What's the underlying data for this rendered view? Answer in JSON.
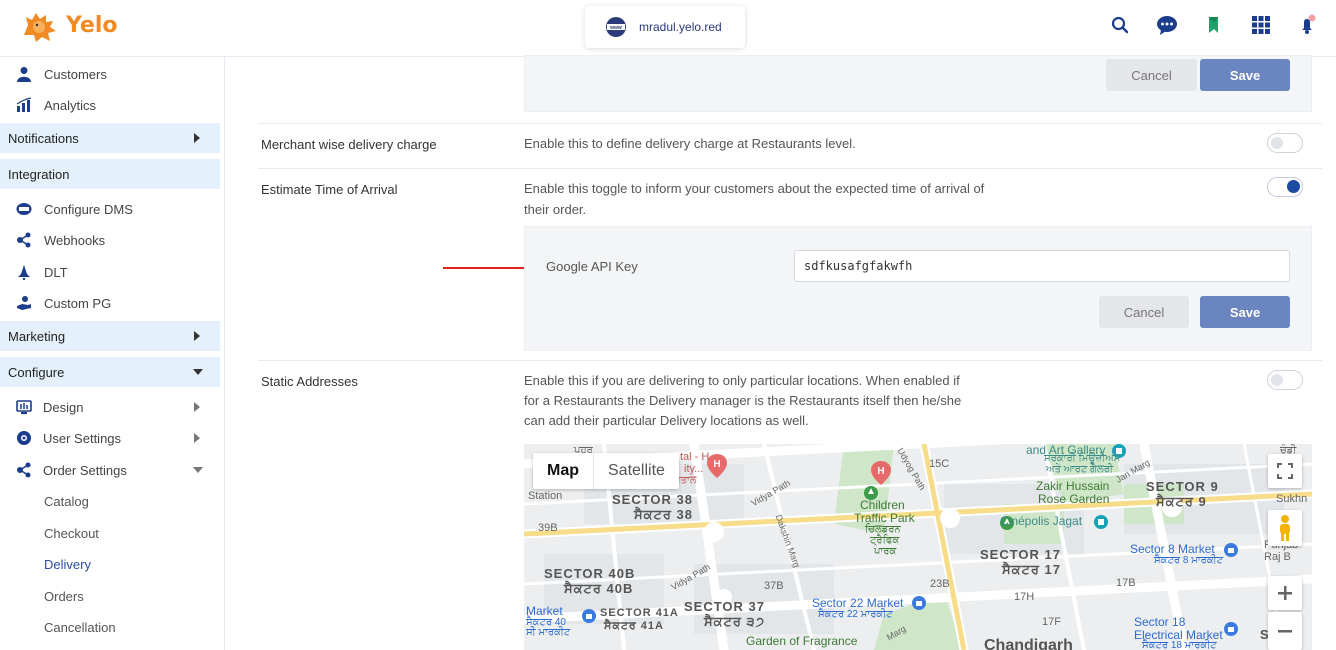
{
  "header": {
    "brand": "Yelo",
    "domain": "mradul.yelo.red",
    "icons": [
      "search-icon",
      "chat-support-icon",
      "bookmark-icon",
      "apps-grid-icon",
      "notification-icon"
    ]
  },
  "sidebar": {
    "top_items": [
      {
        "label": "Customers",
        "icon": "customers-icon"
      },
      {
        "label": "Analytics",
        "icon": "analytics-icon"
      }
    ],
    "notifications": "Notifications",
    "integration": "Integration",
    "integration_items": [
      {
        "label": "Configure DMS",
        "icon": "dms-icon"
      },
      {
        "label": "Webhooks",
        "icon": "webhooks-icon"
      },
      {
        "label": "DLT",
        "icon": "dlt-icon"
      },
      {
        "label": "Custom PG",
        "icon": "custom-pg-icon"
      }
    ],
    "marketing": "Marketing",
    "configure": "Configure",
    "configure_items": [
      {
        "label": "Design",
        "icon": "design-icon"
      },
      {
        "label": "User Settings",
        "icon": "user-settings-icon"
      },
      {
        "label": "Order Settings",
        "icon": "order-settings-icon"
      }
    ],
    "order_settings_items": [
      "Catalog",
      "Checkout",
      "Delivery",
      "Orders",
      "Cancellation"
    ],
    "active_item": "Delivery"
  },
  "main": {
    "top_panel": {
      "cancel": "Cancel",
      "save": "Save"
    },
    "settings": [
      {
        "title": "Merchant wise delivery charge",
        "description": "Enable this to define delivery charge at Restaurants level.",
        "enabled": false
      },
      {
        "title": "Estimate Time of Arrival",
        "description_line1": "Enable this toggle to inform your customers about the expected time of arrival of",
        "description_line2": "their order.",
        "enabled": true
      },
      {
        "title": "Static Addresses",
        "description_line1": "Enable this if you are delivering to only particular locations. When enabled if",
        "description_line2": "for a Restaurants the Delivery manager is the Restaurants itself then he/she",
        "description_line3": "can add their particular Delivery locations as well.",
        "enabled": false
      }
    ],
    "eta_panel": {
      "label": "Google API Key",
      "value": "sdfkusafgfakwfh",
      "cancel": "Cancel",
      "save": "Save"
    },
    "map": {
      "tab_map": "Map",
      "tab_satellite": "Satellite",
      "labels": {
        "sector38": "SECTOR 38",
        "sector38_pa": "ਸੈਕਟਰ 38",
        "sector40b": "SECTOR 40B",
        "sector40b_pa": "ਸੈਕਟਰ 40B",
        "sector37": "SECTOR 37",
        "sector37_pa": "ਸੈਕਟਰ ੩੭",
        "sector41a": "SECTOR 41A",
        "sector41a_pa": "ਸੈਕਟਰ 41A",
        "sector17": "SECTOR 17",
        "sector17_pa": "ਸੈਕਟਰ 17",
        "sector9": "SECTOR 9",
        "sector9_pa": "ਸੈਕਟਰ 9",
        "chandigarh": "Chandigarh",
        "sector_partial": "SEC"
      },
      "pois": {
        "children_park_1": "Children",
        "children_park_2": "Traffic Park",
        "children_park_pa1": "ਚਿਲਡਰਨ",
        "children_park_pa2": "ਟ੍ਰੈਫਿਕ",
        "children_park_pa3": "ਪਾਰਕ",
        "zakir_1": "Zakir Hussain",
        "zakir_2": "Rose Garden",
        "art_gallery": "and Art Gallery",
        "art_gallery_pa1": "ਸਰਕਾਰੀ ਮਿਊਜ਼ੀਅਮ",
        "art_gallery_pa2": "ਅਤੇ ਆਰਟ ਗੈਲਰੀ",
        "cinepolis": "Cinépolis Jagat",
        "sector8_market": "Sector 8 Market",
        "sector8_market_pa": "ਸੈਕਟਰ 8 ਮਾਰਕੀਟ",
        "sector22_market": "Sector 22 Market",
        "sector22_market_pa": "ਸੈਕਟਰ 22 ਮਾਰਕੀਟ",
        "sector18_1": "Sector 18",
        "sector18_2": "Electrical Market",
        "sector18_pa": "ਸੈਕਟਰ 18 ਮਾਰਕੀਟ",
        "garden_fragrance": "Garden of Fragrance",
        "station": "Station",
        "market": "Market",
        "market40_pa1": "ਸੈਕਟਰ 40",
        "market40_pa2": "ਸੀ ਮਾਰਕੀਟ",
        "punjab": "Punjab Raj B",
        "sukhna": "Sukhn",
        "hospital": "tal - H",
        "hospital_2": "ity...",
        "hospital_pa": "ਪਤਾਲ",
        "paharra": "ਪਹਰ",
        "chandi_pa": "ਚੰਡੀ"
      },
      "roads": {
        "r15c": "15C",
        "r37b": "37B",
        "r39b": "39B",
        "r23b": "23B",
        "r17h": "17H",
        "r17b": "17B",
        "r17f": "17F",
        "vidya1": "Vidya Path",
        "vidya2": "Vidya Path",
        "dakshin": "Dakshin Marg",
        "udyog": "Udyog Path",
        "jan": "Jan Marg",
        "marg": "Marg"
      }
    }
  }
}
